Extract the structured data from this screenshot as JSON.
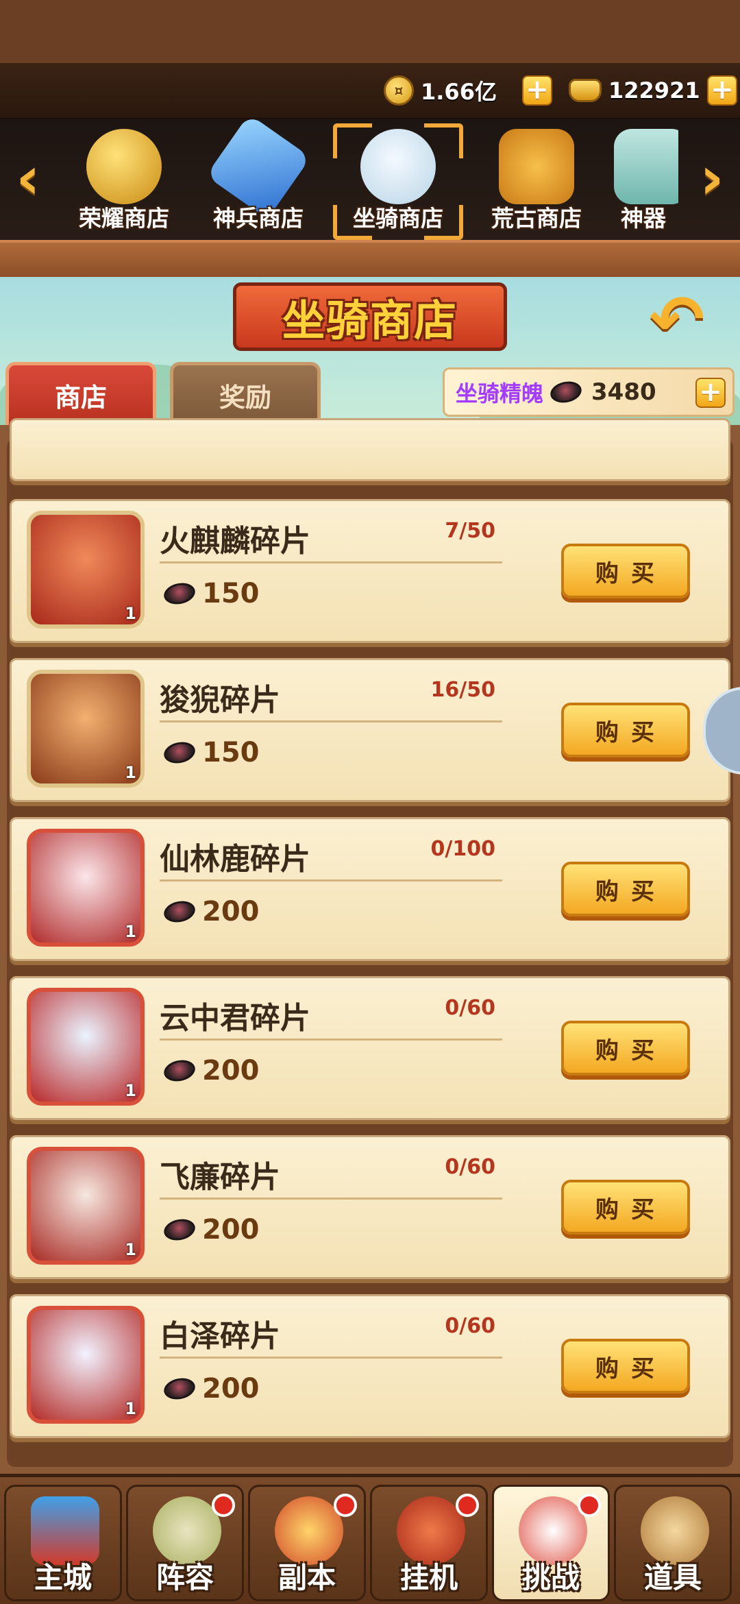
{
  "resources": {
    "gold": {
      "value": "1.66亿",
      "icon": "gold-coin-icon"
    },
    "ingot": {
      "value": "122921",
      "icon": "gold-ingot-icon"
    }
  },
  "store_tabs": [
    {
      "label": "荣耀商店",
      "icon": "honor-medal-icon"
    },
    {
      "label": "神兵商店",
      "icon": "sword-icon"
    },
    {
      "label": "坐骑商店",
      "icon": "deer-mount-icon",
      "selected": true
    },
    {
      "label": "荒古商店",
      "icon": "ancient-token-icon"
    },
    {
      "label": "神器",
      "icon": "artifact-icon"
    }
  ],
  "header": {
    "title": "坐骑商店",
    "tab_shop": "商店",
    "tab_reward": "奖励",
    "currency_name": "坐骑精魄",
    "currency_value": "3480"
  },
  "items": [
    {
      "name": "火麒麟碎片",
      "progress": "7/50",
      "price": "150",
      "count": "1",
      "buy": "购买",
      "color": "#d84a35"
    },
    {
      "name": "狻猊碎片",
      "progress": "16/50",
      "price": "150",
      "count": "1",
      "buy": "购买",
      "color": "#c0562a"
    },
    {
      "name": "仙林鹿碎片",
      "progress": "0/100",
      "price": "200",
      "count": "1",
      "buy": "购买",
      "color": "#e0b0bc"
    },
    {
      "name": "云中君碎片",
      "progress": "0/60",
      "price": "200",
      "count": "1",
      "buy": "购买",
      "color": "#9fc2e0"
    },
    {
      "name": "飞廉碎片",
      "progress": "0/60",
      "price": "200",
      "count": "1",
      "buy": "购买",
      "color": "#e08c7a"
    },
    {
      "name": "白泽碎片",
      "progress": "0/60",
      "price": "200",
      "count": "1",
      "buy": "购买",
      "color": "#c8c8e0"
    }
  ],
  "bottom_nav": [
    {
      "label": "主城",
      "icon": "palace-icon",
      "badge": false
    },
    {
      "label": "阵容",
      "icon": "formation-icon",
      "badge": true
    },
    {
      "label": "副本",
      "icon": "dungeon-icon",
      "badge": true
    },
    {
      "label": "挂机",
      "icon": "idle-bag-icon",
      "badge": true
    },
    {
      "label": "挑战",
      "icon": "challenge-icon",
      "badge": true,
      "selected": true
    },
    {
      "label": "道具",
      "icon": "items-bag-icon",
      "badge": false
    }
  ]
}
